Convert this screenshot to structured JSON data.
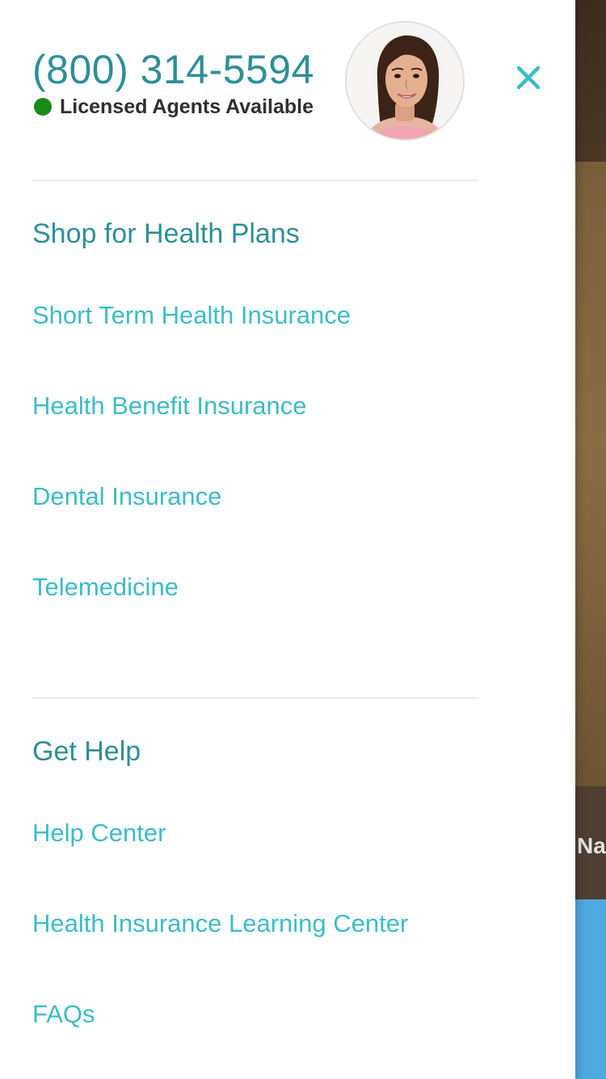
{
  "contact": {
    "phone": "(800) 314-5594",
    "status_label": "Licensed Agents Available",
    "status_color": "#1a8a1a"
  },
  "icons": {
    "close": "close-icon",
    "avatar": "agent-avatar"
  },
  "colors": {
    "heading": "#2e8f98",
    "link": "#3cbcc7",
    "text": "#2f2f2f"
  },
  "shop_section": {
    "title": "Shop for Health Plans",
    "links": [
      "Short Term Health Insurance",
      "Health Benefit Insurance",
      "Dental Insurance",
      "Telemedicine"
    ]
  },
  "help_section": {
    "title": "Get Help",
    "links": [
      "Help Center",
      "Health Insurance Learning Center",
      "FAQs"
    ]
  },
  "background_page": {
    "partial_text": "Na"
  }
}
